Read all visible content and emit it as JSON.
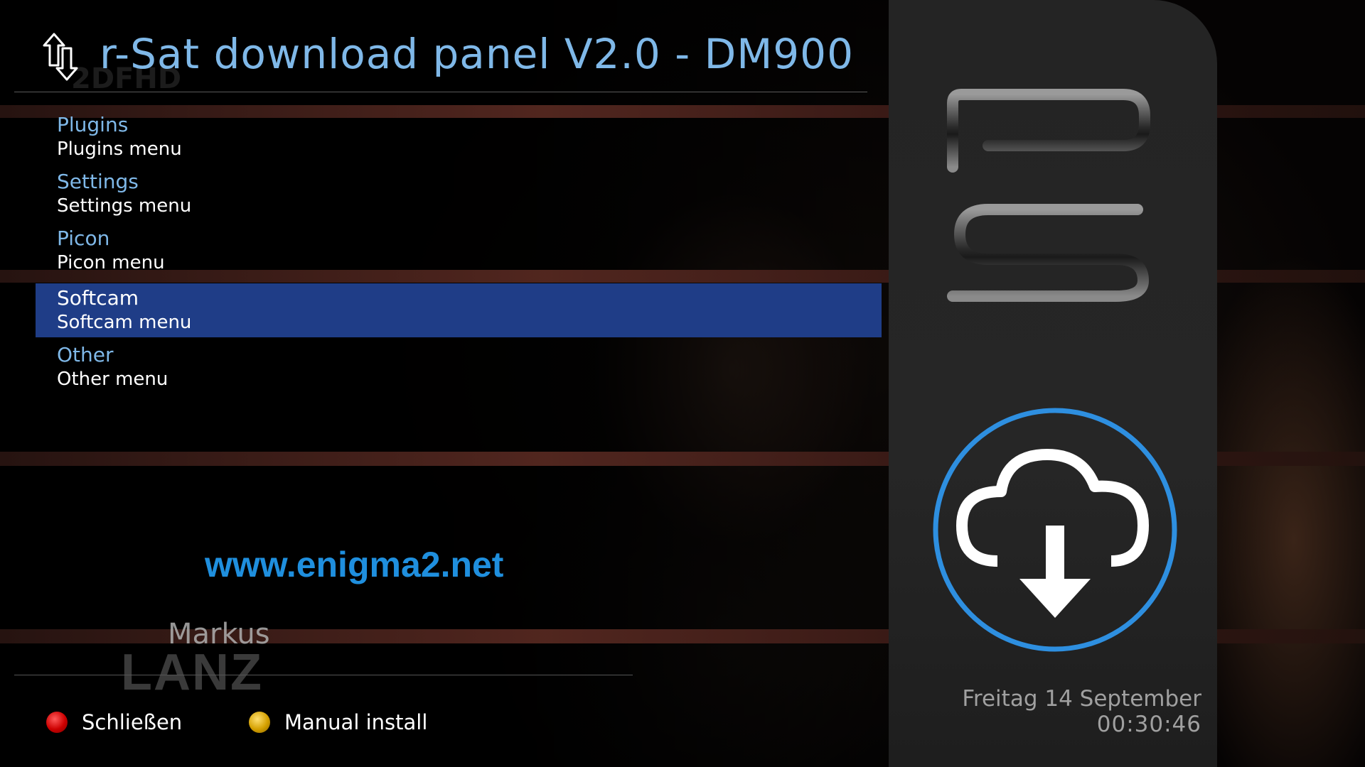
{
  "header": {
    "title": "r-Sat download panel V2.0 - DM900",
    "icon": "up-down-arrows-icon"
  },
  "menu": {
    "items": [
      {
        "title": "Plugins",
        "subtitle": "Plugins menu"
      },
      {
        "title": "Settings",
        "subtitle": "Settings menu"
      },
      {
        "title": "Picon",
        "subtitle": "Picon menu"
      },
      {
        "title": "Softcam",
        "subtitle": "Softcam menu"
      },
      {
        "title": "Other",
        "subtitle": "Other menu"
      }
    ],
    "selected_index": 3
  },
  "website": "www.enigma2.net",
  "watermark": {
    "line1": "Markus",
    "line2": "LANZ",
    "channel": "2DFHD"
  },
  "buttons": {
    "red": {
      "label": "Schließen",
      "color": "#cc0000"
    },
    "yellow": {
      "label": "Manual install",
      "color": "#d4a000"
    }
  },
  "clock": {
    "date": "Freitag 14 September",
    "time": "00:30:46"
  },
  "colors": {
    "title": "#7fb8e8",
    "selection": "#1f3d87",
    "website": "#1f8fde",
    "download_ring": "#2e8fe0"
  },
  "side_panel": {
    "logo_icon": "rs-logo-icon",
    "download_icon": "cloud-download-icon"
  }
}
